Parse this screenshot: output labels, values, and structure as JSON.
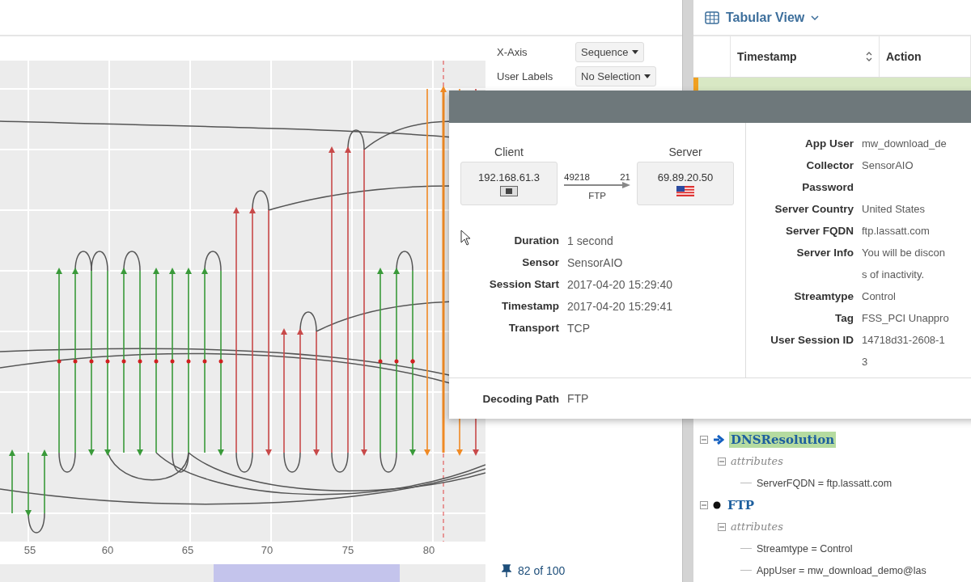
{
  "chart": {
    "x_axis_labels": [
      "55",
      "60",
      "65",
      "70",
      "75",
      "80"
    ],
    "page_count": "82 of 100"
  },
  "controls": [
    {
      "label": "X-Axis",
      "value": "Sequence"
    },
    {
      "label": "User Labels",
      "value": "No Selection"
    }
  ],
  "tabular_view": {
    "title": "Tabular View",
    "columns": [
      "Timestamp",
      "Action"
    ]
  },
  "popup": {
    "client": {
      "label": "Client",
      "address": "192.168.61.3"
    },
    "server": {
      "label": "Server",
      "address": "69.89.20.50"
    },
    "client_port": "49218",
    "server_port": "21",
    "protocol": "FTP",
    "left_fields": [
      {
        "label": "Duration",
        "value": "1 second"
      },
      {
        "label": "Sensor",
        "value": "SensorAIO"
      },
      {
        "label": "Session Start",
        "value": "2017-04-20 15:29:40"
      },
      {
        "label": "Timestamp",
        "value": "2017-04-20 15:29:41"
      },
      {
        "label": "Transport",
        "value": "TCP"
      }
    ],
    "right_fields": [
      {
        "label": "App User",
        "lines": [
          "mw_download_de"
        ]
      },
      {
        "label": "Collector",
        "lines": [
          "SensorAIO"
        ]
      },
      {
        "label": "Password"
      },
      {
        "label": "Server Country",
        "lines": [
          "United States"
        ]
      },
      {
        "label": "Server FQDN",
        "lines": [
          "ftp.lassatt.com"
        ]
      },
      {
        "label": "Server Info",
        "lines": [
          "You will be discon",
          "s of inactivity."
        ]
      },
      {
        "label": "Streamtype",
        "lines": [
          "Control"
        ]
      },
      {
        "label": "Tag",
        "lines": [
          "FSS_PCI Unappro"
        ]
      },
      {
        "label": "User Session ID",
        "lines": [
          "14718d31-2608-1",
          "3"
        ]
      }
    ],
    "decoding_path": {
      "label": "Decoding Path",
      "value": "FTP"
    }
  },
  "tree": [
    {
      "kind": "event",
      "label": "DNSResolution",
      "selected": true,
      "expanded": true,
      "children": [
        {
          "kind": "group",
          "label": "attributes",
          "expanded": true,
          "children": [
            {
              "kind": "attr",
              "label": "ServerFQDN = ftp.lassatt.com"
            }
          ]
        }
      ]
    },
    {
      "kind": "protocol",
      "label": "FTP",
      "selected": false,
      "expanded": true,
      "children": [
        {
          "kind": "group",
          "label": "attributes",
          "expanded": true,
          "children": [
            {
              "kind": "attr",
              "label": "Streamtype = Control"
            },
            {
              "kind": "attr",
              "label": "AppUser = mw_download_demo@las"
            }
          ]
        }
      ]
    }
  ]
}
